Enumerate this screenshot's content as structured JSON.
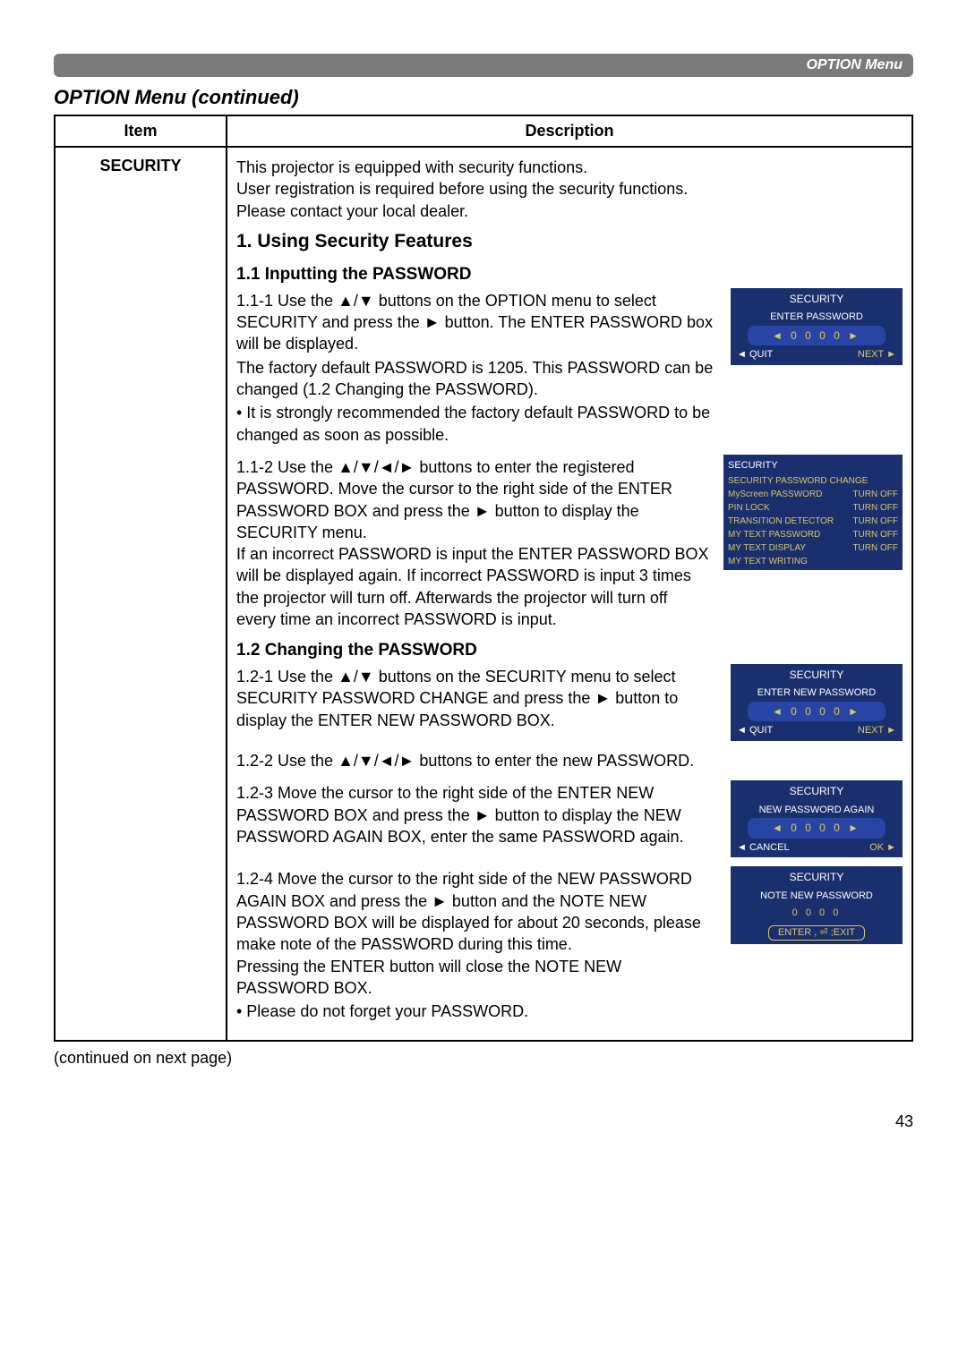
{
  "header": {
    "band": "OPTION Menu",
    "title": "OPTION Menu (continued)"
  },
  "table": {
    "col1": "Item",
    "col2": "Description",
    "item": "SECURITY",
    "intro": "This projector is equipped with security functions.\nUser registration is required before using the security functions.\nPlease contact your local dealer.",
    "s1": "1. Using Security Features",
    "s11": "1.1 Inputting the PASSWORD",
    "s111": "1.1-1 Use the ▲/▼ buttons on the OPTION menu to select SECURITY and press the ► button. The ENTER PASSWORD box will be displayed.",
    "s111b": "The factory default PASSWORD is 1205. This PASSWORD can be changed (1.2 Changing the PASSWORD).",
    "s111c": "• It is strongly recommended the factory default PASSWORD to be changed as soon as possible.",
    "s112": "1.1-2 Use the ▲/▼/◄/► buttons to enter the registered PASSWORD. Move the cursor to the right side of the ENTER PASSWORD BOX and press the ► button to display the SECURITY menu.\nIf an incorrect PASSWORD is input the ENTER PASSWORD BOX will be displayed again. If incorrect PASSWORD is input 3 times the projector will turn off. Afterwards the projector will turn off every time an incorrect PASSWORD is input.",
    "s12": "1.2 Changing the PASSWORD",
    "s121": "1.2-1 Use the ▲/▼ buttons on the SECURITY menu to select SECURITY PASSWORD CHANGE and press the ► button to display the ENTER NEW PASSWORD BOX.",
    "s122": "1.2-2 Use the ▲/▼/◄/► buttons to enter the new PASSWORD.",
    "s123": "1.2-3 Move the cursor to the right side of the ENTER NEW PASSWORD BOX and press the ► button to display the NEW PASSWORD AGAIN BOX, enter the same PASSWORD again.",
    "s124": "1.2-4 Move the cursor to the right side of the NEW PASSWORD AGAIN BOX and press the ► button and the NOTE NEW PASSWORD BOX will be displayed for about 20 seconds, please make note of the PASSWORD during this time.\nPressing the ENTER button will close the NOTE NEW PASSWORD BOX.",
    "s124b": "• Please do not forget your PASSWORD."
  },
  "osd": {
    "box1": {
      "title": "SECURITY",
      "sub": "ENTER PASSWORD",
      "digits": "◄ 0 0 0 0 ►",
      "left": "◄ QUIT",
      "right": "NEXT ►"
    },
    "menu": {
      "title": "SECURITY",
      "items": [
        {
          "lab": "SECURITY PASSWORD CHANGE",
          "val": ""
        },
        {
          "lab": "MyScreen PASSWORD",
          "val": "TURN OFF"
        },
        {
          "lab": "PIN LOCK",
          "val": "TURN OFF"
        },
        {
          "lab": "TRANSITION DETECTOR",
          "val": "TURN OFF"
        },
        {
          "lab": "MY TEXT PASSWORD",
          "val": "TURN OFF"
        },
        {
          "lab": "MY TEXT DISPLAY",
          "val": "TURN OFF"
        },
        {
          "lab": "MY TEXT WRITING",
          "val": ""
        }
      ]
    },
    "box2": {
      "title": "SECURITY",
      "sub": "ENTER NEW PASSWORD",
      "digits": "◄ 0 0 0 0 ►",
      "left": "◄ QUIT",
      "right": "NEXT ►"
    },
    "box3": {
      "title": "SECURITY",
      "sub": "NEW PASSWORD AGAIN",
      "digits": "◄ 0 0 0 0 ►",
      "left": "◄ CANCEL",
      "right": "OK ►"
    },
    "box4": {
      "title": "SECURITY",
      "sub": "NOTE NEW PASSWORD",
      "digits": "0 0 0 0",
      "exit": "ENTER , ⏎ ;EXIT"
    }
  },
  "footer": {
    "continued": "(continued on next page)",
    "page": "43"
  }
}
